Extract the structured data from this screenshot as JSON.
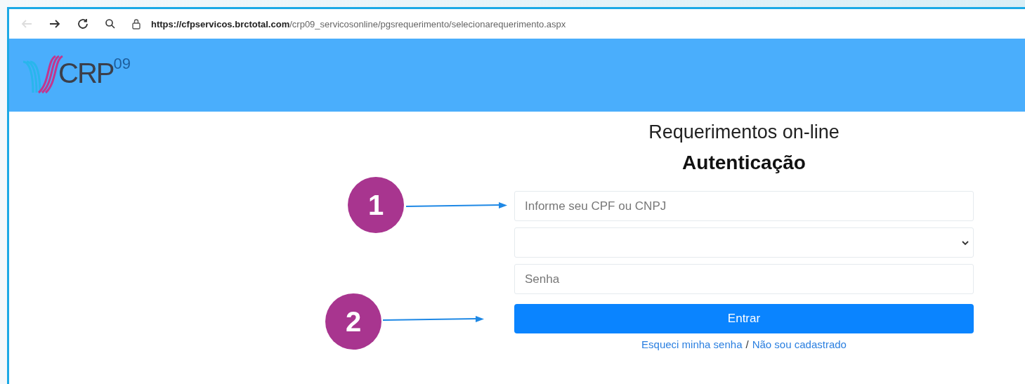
{
  "browser": {
    "url_host": "https://cfpservicos.brctotal.com",
    "url_path": "/crp09_servicosonline/pgsrequerimento/selecionarequerimento.aspx"
  },
  "logo": {
    "letters": "CRP",
    "number": "09"
  },
  "form": {
    "title": "Requerimentos on-line",
    "heading": "Autenticação",
    "cpf_field": {
      "placeholder": "Informe seu CPF ou CNPJ"
    },
    "password_field": {
      "placeholder": "Senha"
    },
    "submit": "Entrar",
    "links": [
      "Esqueci minha senha",
      "Não sou cadastrado"
    ],
    "separator": "/"
  },
  "callouts": [
    {
      "number": "1"
    },
    {
      "number": "2"
    }
  ]
}
